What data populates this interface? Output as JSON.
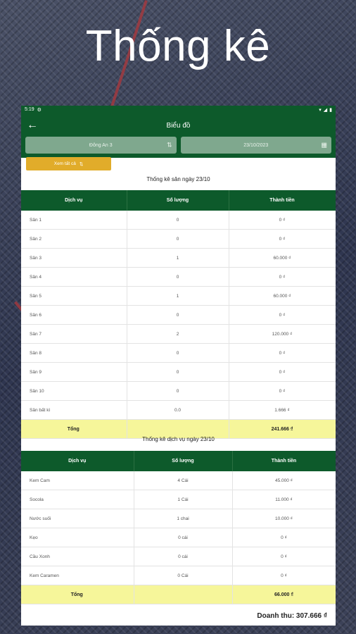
{
  "hero_title": "Thống kê",
  "status_bar": {
    "time": "5:19",
    "left_icon": "notification-icon",
    "right_icons": [
      "wifi-icon",
      "signal-icon",
      "battery-icon"
    ]
  },
  "app_bar": {
    "title": "Biểu đồ",
    "back_icon": "arrow-left-icon"
  },
  "filters": {
    "venue": "Đông An 3",
    "date": "23/10/2023"
  },
  "view_all_label": "Xem tất cả",
  "fields_table": {
    "title": "Thống kê sân ngày 23/10",
    "headers": [
      "Dịch vụ",
      "Số lượng",
      "Thành tiền"
    ],
    "rows": [
      [
        "Sân 1",
        "0",
        "0 ₫"
      ],
      [
        "Sân 2",
        "0",
        "0 ₫"
      ],
      [
        "Sân 3",
        "1",
        "60.000 ₫"
      ],
      [
        "Sân 4",
        "0",
        "0 ₫"
      ],
      [
        "Sân 5",
        "1",
        "60.000 ₫"
      ],
      [
        "Sân 6",
        "0",
        "0 ₫"
      ],
      [
        "Sân 7",
        "2",
        "120.000 ₫"
      ],
      [
        "Sân 8",
        "0",
        "0 ₫"
      ],
      [
        "Sân 9",
        "0",
        "0 ₫"
      ],
      [
        "Sân 10",
        "0",
        "0 ₫"
      ],
      [
        "Sân bất kì",
        "0.0",
        "1.666 ₫"
      ]
    ],
    "total": [
      "Tổng",
      "",
      "241.666 ₫"
    ]
  },
  "services_table": {
    "title": "Thống kê dịch vụ ngày 23/10",
    "headers": [
      "Dịch vụ",
      "Số lượng",
      "Thành tiền"
    ],
    "rows": [
      [
        "Kem Cam",
        "4 Cái",
        "45.000 ₫"
      ],
      [
        "Socola",
        "1 Cái",
        "11.000 ₫"
      ],
      [
        "Nước suối",
        "1 chai",
        "10.000 ₫"
      ],
      [
        "Kẹo",
        "0 cái",
        "0 ₫"
      ],
      [
        "Cầu Xonh",
        "0 cái",
        "0 ₫"
      ],
      [
        "Kem Caramen",
        "0 Cái",
        "0 ₫"
      ]
    ],
    "total": [
      "Tổng",
      "",
      "66.000 ₫"
    ]
  },
  "revenue": "Doanh thu: 307.666 ₫"
}
